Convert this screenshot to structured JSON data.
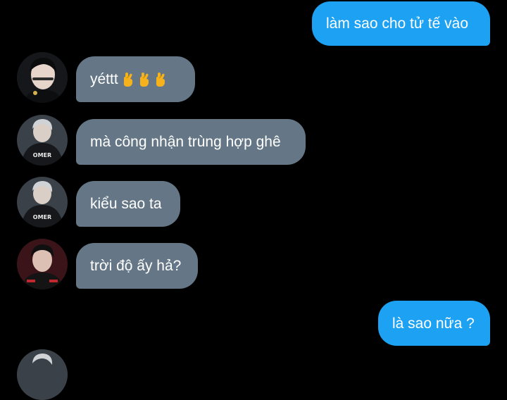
{
  "messages": [
    {
      "side": "out",
      "text": "làm sao cho tử tế vào"
    },
    {
      "side": "in",
      "text": "yéttt",
      "emoji_count": 3,
      "emoji_icon": "crossed-fingers-icon",
      "avatar": "avatar-user-a"
    },
    {
      "side": "in",
      "text": "mà công nhận trùng hợp ghê",
      "avatar": "avatar-user-b"
    },
    {
      "side": "in",
      "text": "kiểu sao ta",
      "avatar": "avatar-user-b"
    },
    {
      "side": "in",
      "text": "trời độ ấy hả?",
      "avatar": "avatar-user-c"
    },
    {
      "side": "out",
      "text": "là sao nữa ?"
    }
  ],
  "avatar_jersey_text": "OMER",
  "colors": {
    "background": "#000000",
    "outgoing_bubble": "#1da1f2",
    "incoming_bubble": "#657786",
    "text": "#ffffff",
    "emoji": "#f5b21c"
  }
}
